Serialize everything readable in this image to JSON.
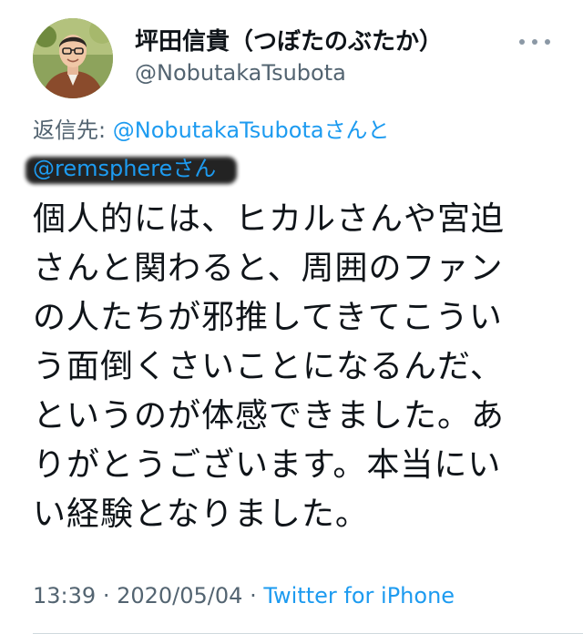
{
  "author": {
    "display_name": "坪田信貴（つぼたのぶたか）",
    "handle": "@NobutakaTsubota"
  },
  "reply": {
    "prefix": "返信先:",
    "mention1": "@NobutakaTsubota",
    "mention1_suffix": "さんと",
    "mention2": "@remsphere",
    "mention2_suffix": "さん"
  },
  "body_lines": [
    "個人的には、ヒカルさんや宮迫",
    "さんと関わると、周囲のファン",
    "の人たちが邪推してきてこうい",
    "う面倒くさいことになるんだ、",
    "というのが体感できました。あ",
    "りがとうございます。本当にい",
    "い経験となりました。"
  ],
  "meta": {
    "time": "13:39",
    "separator": "·",
    "date": "2020/05/04",
    "source": "Twitter for iPhone"
  },
  "colors": {
    "link": "#1d9bf0",
    "secondary_text": "#536471",
    "primary_text": "#0f1419"
  },
  "icons": {
    "more": "more-horizontal-icon"
  }
}
